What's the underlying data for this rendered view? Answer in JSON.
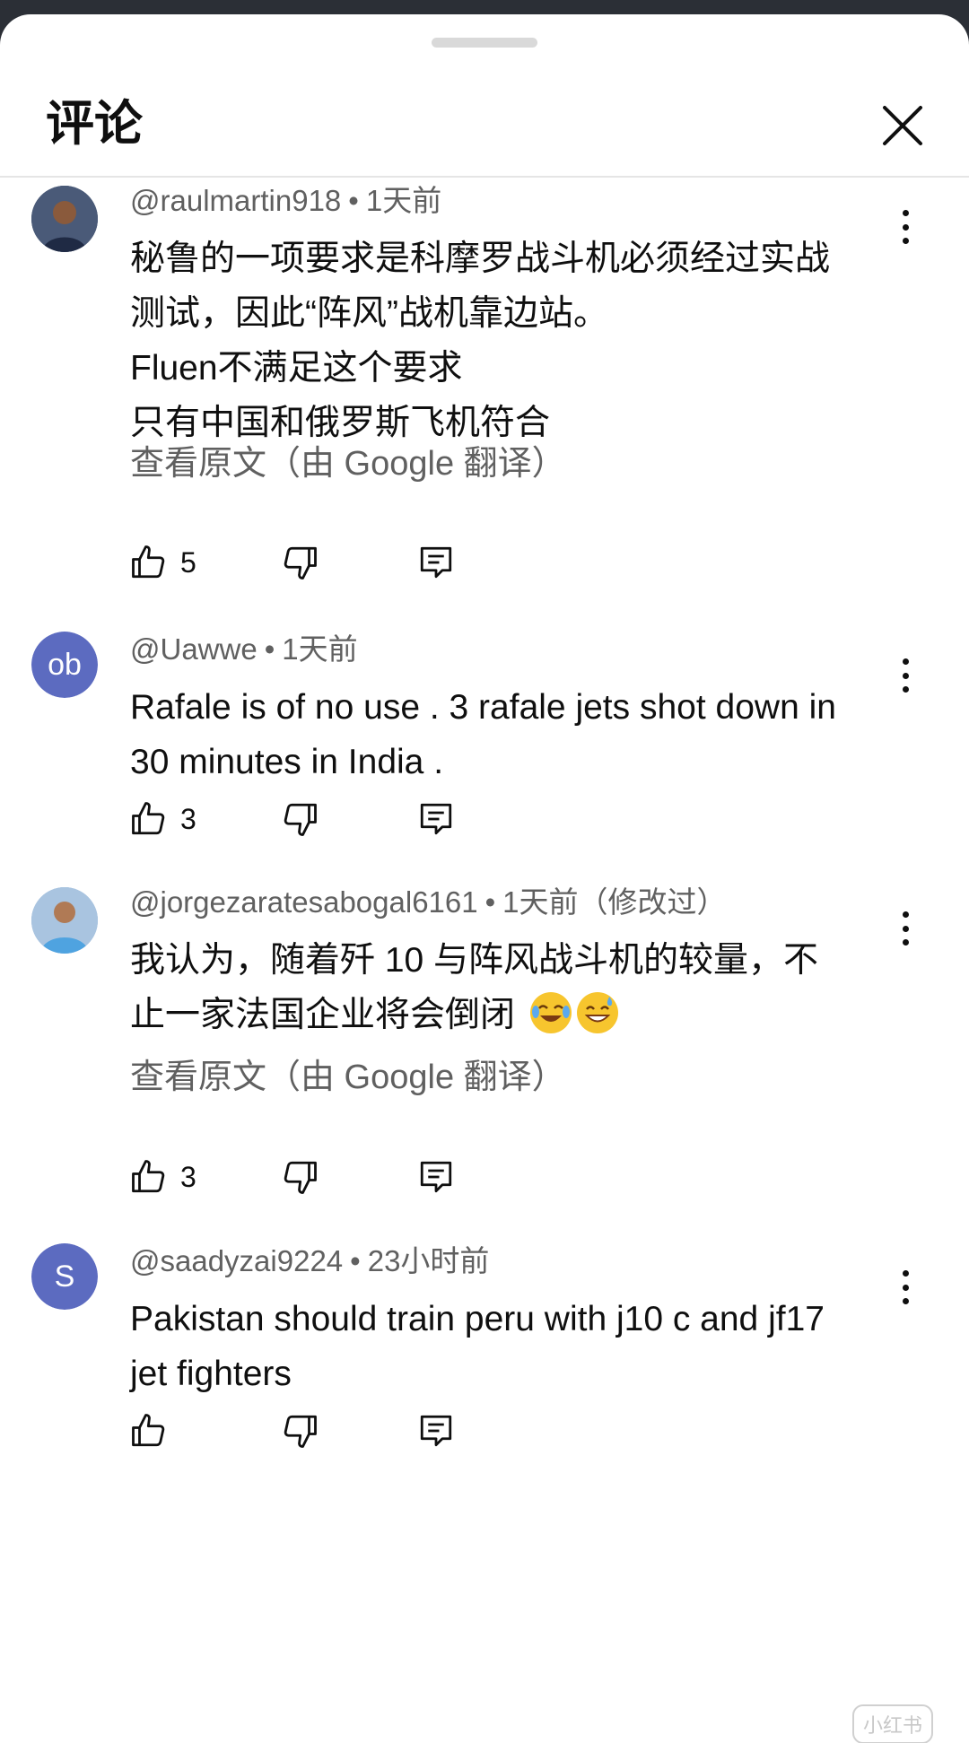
{
  "header": {
    "title": "评论"
  },
  "comments": [
    {
      "author": "@raulmartin918",
      "time": "1天前",
      "edited": "",
      "avatar_text": "",
      "lines": [
        "秘鲁的一项要求是科摩罗战斗机必须经过实战",
        "测试，因此“阵风”战机靠边站。",
        "Fluen不满足这个要求",
        "只有中国和俄罗斯飞机符合"
      ],
      "translate": "查看原文（由 Google 翻译）",
      "likes": "5"
    },
    {
      "author": "@Uawwe",
      "time": "1天前",
      "edited": "",
      "avatar_text": "ob",
      "avatar_color": "#5c6bc0",
      "lines": [
        "Rafale is of no use . 3 rafale jets shot down in",
        "30 minutes in India ."
      ],
      "translate": "",
      "likes": "3"
    },
    {
      "author": "@jorgezaratesabogal6161",
      "time": "1天前",
      "edited": "（修改过）",
      "avatar_text": "",
      "lines": [
        "我认为，随着歼 10 与阵风战斗机的较量，不",
        "止一家法国企业将会倒闭"
      ],
      "emojis": [
        "face-with-tears-of-joy",
        "grinning-face-with-sweat"
      ],
      "translate": "查看原文（由 Google 翻译）",
      "likes": "3"
    },
    {
      "author": "@saadyzai9224",
      "time": "23小时前",
      "edited": "",
      "avatar_text": "S",
      "avatar_color": "#5c6bc0",
      "lines": [
        "Pakistan should train peru with j10 c and jf17",
        "jet fighters"
      ],
      "translate": "",
      "likes": ""
    }
  ],
  "meta_separator": "•",
  "watermark": "小红书"
}
